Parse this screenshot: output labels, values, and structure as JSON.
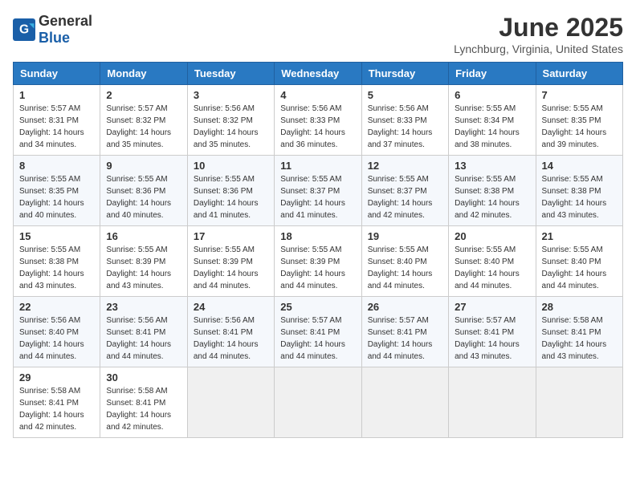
{
  "header": {
    "logo_general": "General",
    "logo_blue": "Blue",
    "month": "June 2025",
    "location": "Lynchburg, Virginia, United States"
  },
  "weekdays": [
    "Sunday",
    "Monday",
    "Tuesday",
    "Wednesday",
    "Thursday",
    "Friday",
    "Saturday"
  ],
  "weeks": [
    [
      {
        "day": "1",
        "sunrise": "5:57 AM",
        "sunset": "8:31 PM",
        "daylight": "14 hours and 34 minutes."
      },
      {
        "day": "2",
        "sunrise": "5:57 AM",
        "sunset": "8:32 PM",
        "daylight": "14 hours and 35 minutes."
      },
      {
        "day": "3",
        "sunrise": "5:56 AM",
        "sunset": "8:32 PM",
        "daylight": "14 hours and 35 minutes."
      },
      {
        "day": "4",
        "sunrise": "5:56 AM",
        "sunset": "8:33 PM",
        "daylight": "14 hours and 36 minutes."
      },
      {
        "day": "5",
        "sunrise": "5:56 AM",
        "sunset": "8:33 PM",
        "daylight": "14 hours and 37 minutes."
      },
      {
        "day": "6",
        "sunrise": "5:55 AM",
        "sunset": "8:34 PM",
        "daylight": "14 hours and 38 minutes."
      },
      {
        "day": "7",
        "sunrise": "5:55 AM",
        "sunset": "8:35 PM",
        "daylight": "14 hours and 39 minutes."
      }
    ],
    [
      {
        "day": "8",
        "sunrise": "5:55 AM",
        "sunset": "8:35 PM",
        "daylight": "14 hours and 40 minutes."
      },
      {
        "day": "9",
        "sunrise": "5:55 AM",
        "sunset": "8:36 PM",
        "daylight": "14 hours and 40 minutes."
      },
      {
        "day": "10",
        "sunrise": "5:55 AM",
        "sunset": "8:36 PM",
        "daylight": "14 hours and 41 minutes."
      },
      {
        "day": "11",
        "sunrise": "5:55 AM",
        "sunset": "8:37 PM",
        "daylight": "14 hours and 41 minutes."
      },
      {
        "day": "12",
        "sunrise": "5:55 AM",
        "sunset": "8:37 PM",
        "daylight": "14 hours and 42 minutes."
      },
      {
        "day": "13",
        "sunrise": "5:55 AM",
        "sunset": "8:38 PM",
        "daylight": "14 hours and 42 minutes."
      },
      {
        "day": "14",
        "sunrise": "5:55 AM",
        "sunset": "8:38 PM",
        "daylight": "14 hours and 43 minutes."
      }
    ],
    [
      {
        "day": "15",
        "sunrise": "5:55 AM",
        "sunset": "8:38 PM",
        "daylight": "14 hours and 43 minutes."
      },
      {
        "day": "16",
        "sunrise": "5:55 AM",
        "sunset": "8:39 PM",
        "daylight": "14 hours and 43 minutes."
      },
      {
        "day": "17",
        "sunrise": "5:55 AM",
        "sunset": "8:39 PM",
        "daylight": "14 hours and 44 minutes."
      },
      {
        "day": "18",
        "sunrise": "5:55 AM",
        "sunset": "8:39 PM",
        "daylight": "14 hours and 44 minutes."
      },
      {
        "day": "19",
        "sunrise": "5:55 AM",
        "sunset": "8:40 PM",
        "daylight": "14 hours and 44 minutes."
      },
      {
        "day": "20",
        "sunrise": "5:55 AM",
        "sunset": "8:40 PM",
        "daylight": "14 hours and 44 minutes."
      },
      {
        "day": "21",
        "sunrise": "5:55 AM",
        "sunset": "8:40 PM",
        "daylight": "14 hours and 44 minutes."
      }
    ],
    [
      {
        "day": "22",
        "sunrise": "5:56 AM",
        "sunset": "8:40 PM",
        "daylight": "14 hours and 44 minutes."
      },
      {
        "day": "23",
        "sunrise": "5:56 AM",
        "sunset": "8:41 PM",
        "daylight": "14 hours and 44 minutes."
      },
      {
        "day": "24",
        "sunrise": "5:56 AM",
        "sunset": "8:41 PM",
        "daylight": "14 hours and 44 minutes."
      },
      {
        "day": "25",
        "sunrise": "5:57 AM",
        "sunset": "8:41 PM",
        "daylight": "14 hours and 44 minutes."
      },
      {
        "day": "26",
        "sunrise": "5:57 AM",
        "sunset": "8:41 PM",
        "daylight": "14 hours and 44 minutes."
      },
      {
        "day": "27",
        "sunrise": "5:57 AM",
        "sunset": "8:41 PM",
        "daylight": "14 hours and 43 minutes."
      },
      {
        "day": "28",
        "sunrise": "5:58 AM",
        "sunset": "8:41 PM",
        "daylight": "14 hours and 43 minutes."
      }
    ],
    [
      {
        "day": "29",
        "sunrise": "5:58 AM",
        "sunset": "8:41 PM",
        "daylight": "14 hours and 42 minutes."
      },
      {
        "day": "30",
        "sunrise": "5:58 AM",
        "sunset": "8:41 PM",
        "daylight": "14 hours and 42 minutes."
      },
      null,
      null,
      null,
      null,
      null
    ]
  ]
}
